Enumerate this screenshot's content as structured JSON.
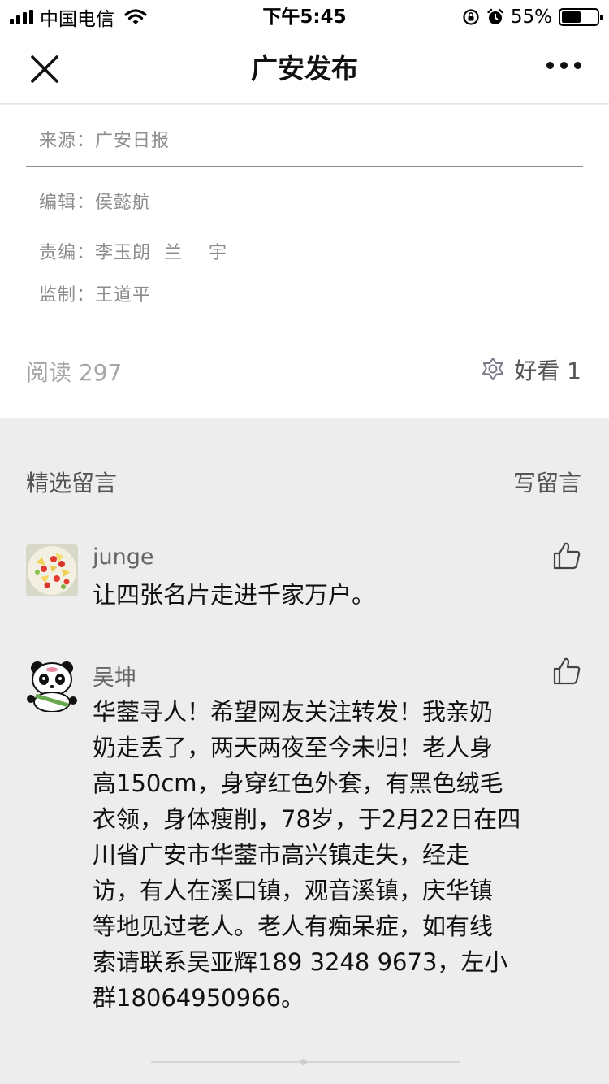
{
  "status_bar": {
    "carrier": "中国电信",
    "time": "下午5:45",
    "battery": "55%",
    "battery_level": 0.55
  },
  "nav": {
    "title": "广安发布",
    "close_icon": "close-icon",
    "more_icon": "more-icon"
  },
  "article_meta": {
    "source": "来源：广安日报",
    "editor": "编辑：侯懿航",
    "responsible_editor": "责编：李玉朗  兰    宇",
    "supervisor": "监制：王道平"
  },
  "stats": {
    "read": "阅读 297",
    "like": "好看 1"
  },
  "comments_section": {
    "header": "精选留言",
    "write": "写留言"
  },
  "comments": [
    {
      "author": "junge",
      "avatar": "fruit-salad-avatar",
      "text": "让四张名片走进千家万户。"
    },
    {
      "author": "吴坤",
      "avatar": "panda-avatar",
      "lines": [
        "华蓥寻人！希望网友关注转发！我亲奶",
        "奶走丢了，两天两夜至今未归！老人身",
        "高150cm，身穿红色外套，有黑色绒毛",
        "衣领，身体瘦削，78岁，于2月22日在四",
        "川省广安市华蓥市高兴镇走失，经走",
        "访，有人在溪口镇，观音溪镇，庆华镇",
        "等地见过老人。老人有痴呆症，如有线",
        "索请联系吴亚辉189 3248 9673，左小",
        "群18064950966。"
      ]
    }
  ],
  "colors": {
    "background": "#ededed",
    "card": "#ffffff",
    "meta_text": "#8c8c8c",
    "body_text": "#111111"
  }
}
